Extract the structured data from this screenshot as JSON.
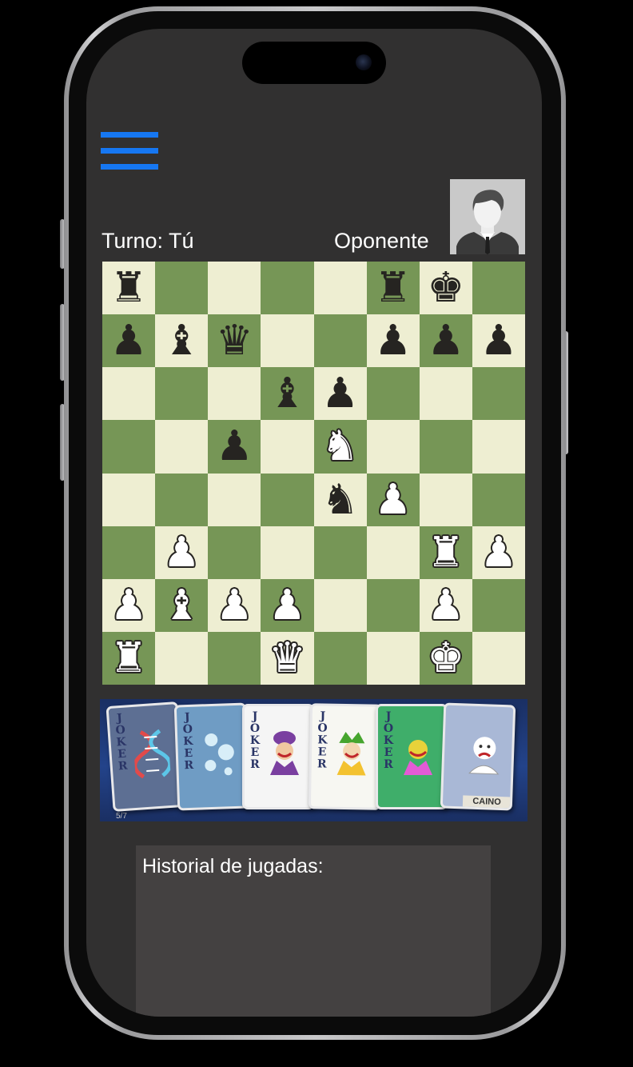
{
  "menu": {
    "icon": "hamburger-menu-icon",
    "color": "#1677f2"
  },
  "game": {
    "turn_text": "Turno: Tú",
    "opponent_text": "Oponente",
    "opponent_avatar_icon": "user-avatar-icon"
  },
  "board": {
    "light_color": "#eeeed2",
    "dark_color": "#769656",
    "ranks": [
      [
        "r",
        "",
        "",
        "",
        "",
        "r",
        "k",
        ""
      ],
      [
        "p",
        "b",
        "q",
        "",
        "",
        "p",
        "p",
        "p"
      ],
      [
        "",
        "",
        "",
        "b",
        "p",
        "",
        "",
        ""
      ],
      [
        "",
        "",
        "p",
        "",
        "N",
        "",
        "",
        ""
      ],
      [
        "",
        "",
        "",
        "",
        "n",
        "P",
        "",
        ""
      ],
      [
        "",
        "P",
        "",
        "",
        "",
        "",
        "R",
        "P"
      ],
      [
        "P",
        "B",
        "P",
        "P",
        "",
        "",
        "P",
        ""
      ],
      [
        "R",
        "",
        "",
        "Q",
        "",
        "",
        "K",
        ""
      ]
    ]
  },
  "cards": {
    "items": [
      {
        "title": "JOKER",
        "art": "dna-helix-icon",
        "bg": "#5d6f93",
        "accent": "#e24a4a"
      },
      {
        "title": "JOKER",
        "art": "ice-splash-icon",
        "bg": "#6f9cc4",
        "accent": "#d8eef8"
      },
      {
        "title": "JOKER",
        "art": "joker-face-icon",
        "bg": "#f5f5f5",
        "accent": "#7a3fa0"
      },
      {
        "title": "JOKER",
        "art": "jester-icon",
        "bg": "#f7f7f2",
        "accent": "#46a52e"
      },
      {
        "title": "JOKER",
        "art": "rainbow-joker-icon",
        "bg": "#3fae6a",
        "accent": "#e8d23a"
      },
      {
        "title": "",
        "art": "sad-clown-icon",
        "bg": "#a9b8d6",
        "accent": "#ffffff",
        "caption": "CAINO"
      }
    ],
    "counter": "5/7"
  },
  "history": {
    "title": "Historial de jugadas:"
  }
}
